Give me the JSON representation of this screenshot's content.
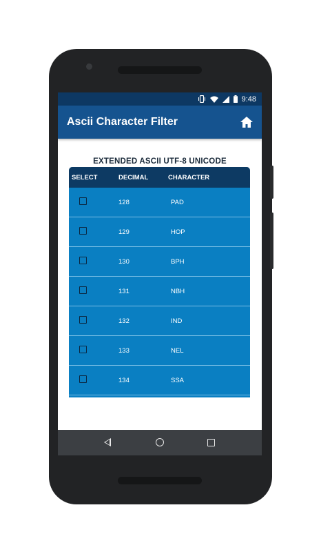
{
  "status_bar": {
    "time": "9:48",
    "icons": [
      "vibrate-icon",
      "wifi-icon",
      "signal-icon",
      "battery-icon"
    ]
  },
  "app_bar": {
    "title": "Ascii Character Filter",
    "home_icon": "home-icon"
  },
  "table": {
    "title": "EXTENDED ASCII UTF-8 UNICODE",
    "headers": {
      "select": "SELECT",
      "decimal": "DECIMAL",
      "character": "CHARACTER"
    },
    "rows": [
      {
        "decimal": "128",
        "character": "PAD",
        "checked": false
      },
      {
        "decimal": "129",
        "character": "HOP",
        "checked": false
      },
      {
        "decimal": "130",
        "character": "BPH",
        "checked": false
      },
      {
        "decimal": "131",
        "character": "NBH",
        "checked": false
      },
      {
        "decimal": "132",
        "character": "IND",
        "checked": false
      },
      {
        "decimal": "133",
        "character": "NEL",
        "checked": false
      },
      {
        "decimal": "134",
        "character": "SSA",
        "checked": false
      }
    ]
  },
  "nav_bar": {
    "icons": [
      "back-icon",
      "home-circle-icon",
      "recents-icon"
    ]
  },
  "colors": {
    "status_bar": "#0d3863",
    "app_bar": "#15538f",
    "table_header": "#0d3a63",
    "table_body": "#0a7fc2",
    "nav_bar": "#3c3f43"
  }
}
